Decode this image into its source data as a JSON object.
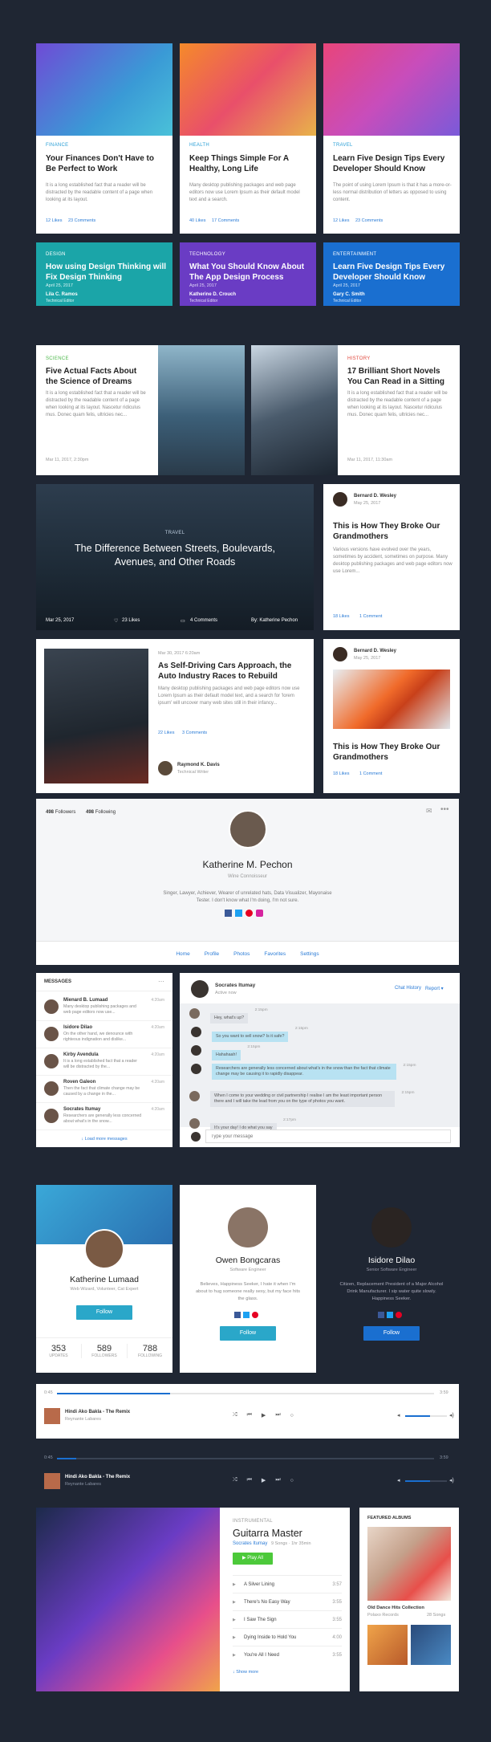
{
  "colors": {
    "bg": "#1f2633",
    "accent": "#2a9fd6",
    "purple": "#6a3cc4",
    "blue": "#1a6fd0",
    "teal": "#1ba5a8",
    "green": "#4cc93a"
  },
  "blog_cards": [
    {
      "category": "Finance",
      "title": "Your Finances Don't Have to Be Perfect to Work",
      "body": "It is a long established fact that a reader will be distracted by the readable content of a page when looking at its layout.",
      "likes": "12 Likes",
      "comments": "23 Comments"
    },
    {
      "category": "Health",
      "title": "Keep Things Simple For A Healthy, Long Life",
      "body": "Many desktop publishing packages and web page editors now use Lorem Ipsum as their default model text and a search.",
      "likes": "40 Likes",
      "comments": "17 Comments"
    },
    {
      "category": "Travel",
      "title": "Learn Five Design Tips Every Developer Should Know",
      "body": "The point of using Lorem Ipsum is that it has a more-or-less normal distribution of letters as opposed to using content.",
      "likes": "12 Likes",
      "comments": "23 Comments"
    }
  ],
  "color_cards": [
    {
      "category": "Design",
      "title": "How using Design Thinking will Fix Design Thinking",
      "date": "April 25, 2017",
      "author": "Lila C. Ramos",
      "role": "Technical Editor"
    },
    {
      "category": "Technology",
      "title": "What You Should Know About The App Design Process",
      "date": "April 25, 2017",
      "author": "Katherine D. Crouch",
      "role": "Technical Editor"
    },
    {
      "category": "Entertainment",
      "title": "Learn Five Design Tips Every Developer Should Know",
      "date": "April 25, 2017",
      "author": "Gary C. Smith",
      "role": "Technical Editor"
    }
  ],
  "wide_cards": [
    {
      "category": "Science",
      "title": "Five Actual Facts About the Science of Dreams",
      "body": "It is a long established fact that a reader will be distracted by the readable content of a page when looking at its layout. Nascetur ridiculus mus. Donec quam felis, ultricies nec...",
      "date": "Mar 11, 2017, 2:30pm"
    },
    {
      "category": "History",
      "title": "17 Brilliant Short Novels You Can Read in a Sitting",
      "body": "It is a long established fact that a reader will be distracted by the readable content of a page when looking at its layout. Nascetur ridiculus mus. Donec quam felis, ultricies nec...",
      "date": "Mar 11, 2017, 11:30am"
    }
  ],
  "hero": {
    "category": "Travel",
    "title": "The Difference Between Streets, Boulevards, Avenues, and Other Roads",
    "date": "Mar 25, 2017",
    "likes": "23 Likes",
    "comments": "4 Comments",
    "by": "By: Katherine Pechon"
  },
  "side_post1": {
    "author": "Bernard D. Wesley",
    "date": "May 25, 2017",
    "title": "This is How They Broke Our Grandmothers",
    "body": "Various versions have evolved over the years, sometimes by accident, sometimes on purpose. Many desktop publishing packages and web page editors now use Lorem...",
    "likes": "18 Likes",
    "comments": "1 Comment"
  },
  "car_post": {
    "date": "Mar 30, 2017 6:20am",
    "title": "As Self-Driving Cars Approach, the Auto Industry Races to Rebuild",
    "body": "Many desktop publishing packages and web page editors now use Lorem Ipsum as their default model text, and a search for 'lorem ipsum' will uncover many web sites still in their infancy...",
    "likes": "22 Likes",
    "comments": "3 Comments",
    "author": "Raymond K. Davis",
    "role": "Technical Writer"
  },
  "side_post2": {
    "author": "Bernard D. Wesley",
    "date": "May 25, 2017",
    "title": "This is How They Broke Our Grandmothers",
    "likes": "18 Likes",
    "comments": "1 Comment"
  },
  "profile": {
    "followers_n": "498",
    "followers": "Followers",
    "following_n": "498",
    "following": "Following",
    "name": "Katherine M. Pechon",
    "role": "Wine Connoisseur",
    "bio": "Singer, Lawyer, Achiever, Wearer of unrelated hats, Data Visualizer, Mayonaise Tester. I don't know what I'm doing, I'm not sure.",
    "tabs": [
      "Home",
      "Profile",
      "Photos",
      "Favorites",
      "Settings"
    ]
  },
  "messages": {
    "title": "Messages",
    "items": [
      {
        "name": "Mienard B. Lumaad",
        "time": "4:20am",
        "text": "Many desktop publishing packages and web page editors now use..."
      },
      {
        "name": "Isidore Dilao",
        "time": "4:20am",
        "text": "On the other hand, we denounce with righteous indignation and dislike..."
      },
      {
        "name": "Kirby Avendula",
        "time": "4:20am",
        "text": "It is a long established fact that a reader will be distracted by the..."
      },
      {
        "name": "Roven Galeon",
        "time": "4:20am",
        "text": "Then the fact that climate change may be caused by a change in the..."
      },
      {
        "name": "Socrates Itumay",
        "time": "4:20am",
        "text": "Researchers are generally less concerned about what's in the snow..."
      }
    ],
    "load_more": "Load more messages"
  },
  "chat": {
    "name": "Socrates Itumay",
    "status": "Active now",
    "history": "Chat History",
    "report": "Report",
    "msgs": [
      {
        "side": "l",
        "text": "Hey, what's up?",
        "time": "2:15pm"
      },
      {
        "side": "r",
        "text": "So you want to sell snow? Is it safe?",
        "time": "2:15pm"
      },
      {
        "side": "r",
        "text": "Hahahaah!",
        "time": "2:15pm"
      },
      {
        "side": "r",
        "text": "Researchers are generally less concerned about what's in the snow than the fact that climate change may be causing it to rapidly disappear.",
        "time": "2:15pm"
      },
      {
        "side": "l",
        "text": "When I come to your wedding or civil partnership I realise I am the least important person there and I will take the lead from you on the type of photos you want.",
        "time": "2:15pm"
      },
      {
        "side": "l",
        "text": "It's your day! I do what you say",
        "time": "2:17pm"
      }
    ],
    "placeholder": "Type your message"
  },
  "user1": {
    "name": "Katherine Lumaad",
    "role": "Web Wizard, Volunteer, Cat Expert",
    "follow": "Follow",
    "stats": [
      {
        "n": "353",
        "l": "Updates"
      },
      {
        "n": "589",
        "l": "Followers"
      },
      {
        "n": "788",
        "l": "Following"
      }
    ]
  },
  "user2": {
    "name": "Owen Bongcaras",
    "role": "Software Engineer",
    "bio": "Believes, Happiness Seeker, I hate it when I'm about to hug someone really sexy, but my face hits the glass.",
    "follow": "Follow"
  },
  "user3": {
    "name": "Isidore Dilao",
    "role": "Senior Software Engineer",
    "bio": "Citizen, Replacement President of a Major Alcohol Drink Manufacturer. I sip water quite slowly. Happiness Seeker.",
    "follow": "Follow"
  },
  "player1": {
    "elapsed": "0:45",
    "total": "3:59",
    "progress": 0.3,
    "song": "Hindi Ako Bakla - The Remix",
    "artist": "Reynante Labares",
    "volume": 0.6
  },
  "player2": {
    "elapsed": "0:45",
    "total": "3:59",
    "progress": 0.05,
    "song": "Hindi Ako Bakla - The Remix",
    "artist": "Reynante Labares",
    "volume": 0.6
  },
  "album": {
    "genre": "Instrumental",
    "title": "Guitarra Master",
    "artist": "Socrates Itumay",
    "info": "9 Songs · 1hr 35min",
    "play": "Play All",
    "tracks": [
      {
        "n": "1",
        "t": "A Silver Lining",
        "d": "3:57"
      },
      {
        "n": "2",
        "t": "There's No Easy Way",
        "d": "3:55"
      },
      {
        "n": "3",
        "t": "I Saw The Sign",
        "d": "3:55"
      },
      {
        "n": "4",
        "t": "Dying Inside to Hold You",
        "d": "4:00"
      },
      {
        "n": "5",
        "t": "You're All I Need",
        "d": "3:55"
      }
    ],
    "more": "Show more"
  },
  "featured": {
    "title": "Featured Albums",
    "album": "Old Dance Hits Collection",
    "label": "Polaxo Records",
    "count": "28 Songs"
  }
}
